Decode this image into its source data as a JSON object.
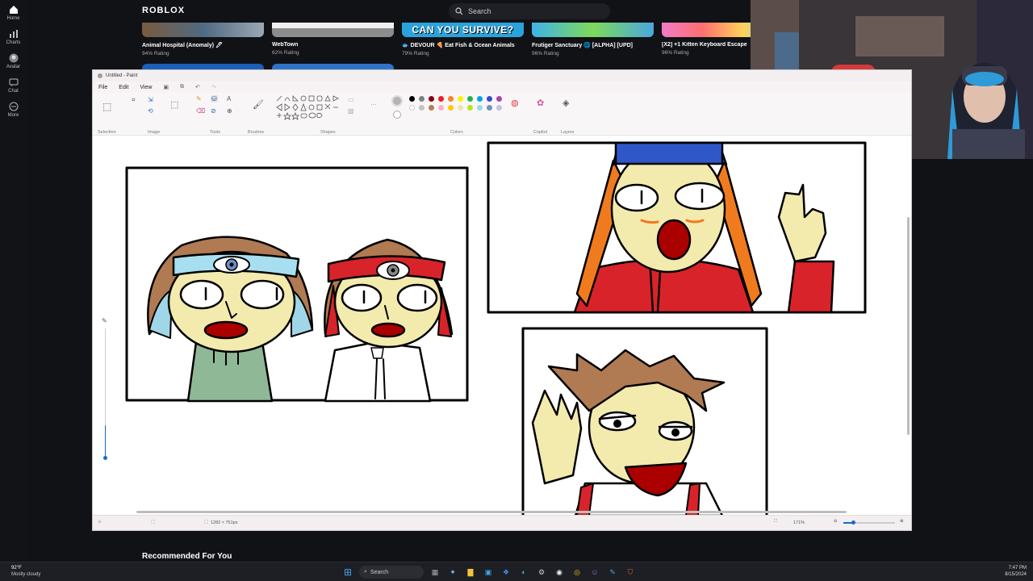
{
  "roblox": {
    "logo": "ROBLOX",
    "search_placeholder": "Search",
    "nav": [
      {
        "label": "Home",
        "icon": "home-icon"
      },
      {
        "label": "Charts",
        "icon": "charts-icon"
      },
      {
        "label": "Avatar",
        "icon": "avatar-icon"
      },
      {
        "label": "Chat",
        "icon": "chat-icon"
      },
      {
        "label": "More",
        "icon": "more-icon"
      }
    ],
    "games": [
      {
        "title": "Animal Hospital (Anomaly) 🖊",
        "rating": "94% Rating",
        "color": "#5a6b7d"
      },
      {
        "title": "WebTown",
        "rating": "62% Rating",
        "color": "#8f8f8f"
      },
      {
        "title": "🐟 DEVOUR 🍕 Eat Fish & Ocean Animals",
        "rating": "79% Rating",
        "color": "#2fa0d8",
        "banner": "CAN YOU SURVIVE?"
      },
      {
        "title": "Frutiger Sanctuary 🌐 [ALPHA] [UPD]",
        "rating": "96% Rating",
        "color": "#3aa0d8"
      },
      {
        "title": "[X2] +1 Kitten Keyboard Escape",
        "rating": "96% Rating",
        "color": "#e85fb0"
      }
    ],
    "recommended": "Recommended For You"
  },
  "paint": {
    "title": "Untitled - Paint",
    "menu": [
      "File",
      "Edit",
      "View"
    ],
    "groups": [
      "Selection",
      "Image",
      "Tools",
      "Brushes",
      "Shapes",
      "Colors",
      "Copilot",
      "Layers"
    ],
    "palette_row1": [
      "#000000",
      "#7f7f7f",
      "#880015",
      "#ed1c24",
      "#ff7f27",
      "#fff200",
      "#22b14c",
      "#00a2e8",
      "#3f48cc",
      "#a349a4"
    ],
    "palette_row2": [
      "#ffffff",
      "#c3c3c3",
      "#b97a57",
      "#ffaec9",
      "#ffc90e",
      "#efe4b0",
      "#b5e61d",
      "#99d9ea",
      "#7092be",
      "#c8bfe7"
    ],
    "canvas_size": "1282 × 751px",
    "zoom": "171%"
  },
  "taskbar": {
    "temperature": "92°F",
    "weather": "Mostly cloudy",
    "search": "Search",
    "time": "7:47 PM",
    "date": "8/15/2024"
  }
}
